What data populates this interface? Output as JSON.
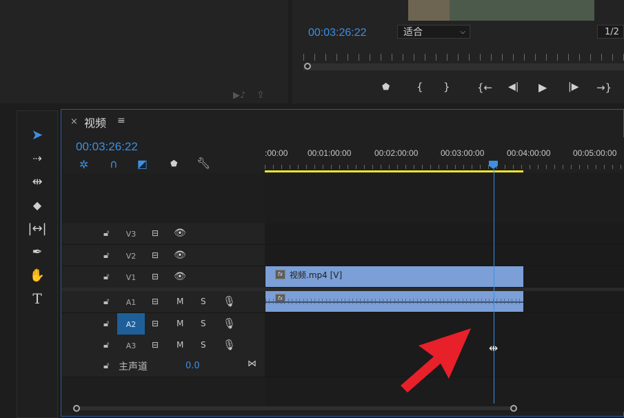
{
  "program_monitor": {
    "timecode": "00:03:26:22",
    "fit_label": "适合",
    "resolution": "1/2"
  },
  "timeline": {
    "tab_title": "视频",
    "timecode": "00:03:26:22",
    "ruler_labels": [
      ":00:00",
      "00:01:00:00",
      "00:02:00:00",
      "00:03:00:00",
      "00:04:00:00",
      "00:05:00:00"
    ],
    "video_tracks": [
      "V3",
      "V2",
      "V1"
    ],
    "audio_tracks": [
      "A1",
      "A2",
      "A3"
    ],
    "master_label": "主声道",
    "master_value": "0.0",
    "mute_label": "M",
    "solo_label": "S",
    "video_clip_label": "视频.mp4 [V]",
    "fx_label": "fx"
  },
  "colors": {
    "accent": "#3d8fe3",
    "clip": "#7b9fd6",
    "work_area": "#f0e628",
    "arrow": "#e8202a"
  }
}
